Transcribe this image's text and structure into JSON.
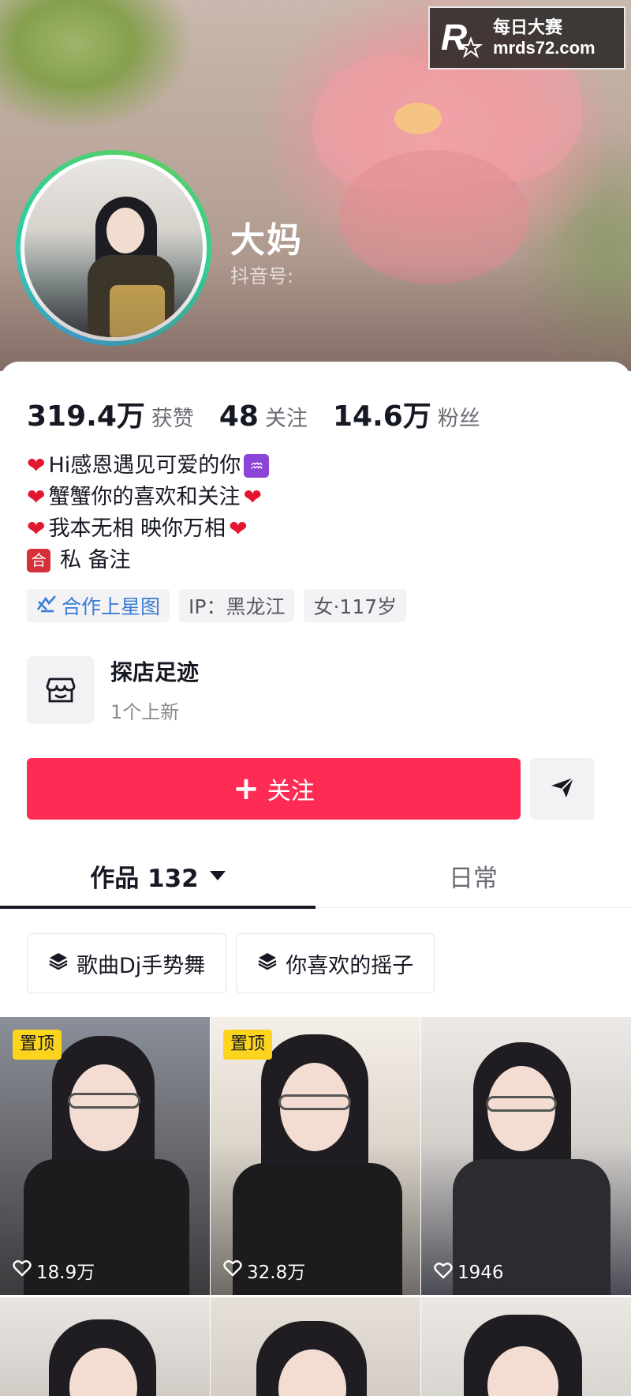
{
  "watermark": {
    "brand_line1": "每日大赛",
    "brand_line2": "mrds72.com",
    "logo_letter": "R"
  },
  "profile": {
    "name": "大妈",
    "douyin_id_label": "抖音号:",
    "stats": [
      {
        "value": "319.4万",
        "label": "获赞"
      },
      {
        "value": "48",
        "label": "关注"
      },
      {
        "value": "14.6万",
        "label": "粉丝"
      }
    ],
    "bio": [
      {
        "prefix_icon": "heart-icon",
        "text": "Hi感恩遇见可爱的你",
        "suffix_icon": "aquarius-icon"
      },
      {
        "prefix_icon": "heart-icon",
        "text": "蟹蟹你的喜欢和关注",
        "suffix_icon": "heart-icon"
      },
      {
        "prefix_icon": "heart-icon",
        "text": "我本无相 映你万相",
        "suffix_icon": "heart-icon"
      },
      {
        "prefix_icon": "he-badge-icon",
        "badge_text": "合",
        "text": "私 备注"
      }
    ],
    "tags": [
      {
        "label": "合作上星图",
        "icon": "xingtu-icon",
        "color": "#3a7bd5"
      },
      {
        "label": "IP：黑龙江"
      },
      {
        "label": "女·117岁"
      }
    ],
    "shop": {
      "title": "探店足迹",
      "subtitle": "1个上新",
      "icon": "store-icon"
    }
  },
  "actions": {
    "follow_plus": "+",
    "follow_label": "关注",
    "follow_color": "#fe2c55",
    "send_icon": "send-icon"
  },
  "tabs": [
    {
      "label": "作品 132",
      "active": true
    },
    {
      "label": "日常",
      "active": false
    }
  ],
  "collections": [
    {
      "label": "歌曲Dj手势舞",
      "icon": "layers-icon"
    },
    {
      "label": "你喜欢的摇子",
      "icon": "layers-icon"
    }
  ],
  "videos": [
    {
      "pinned": true,
      "pin_label": "置顶",
      "likes": "18.9万"
    },
    {
      "pinned": true,
      "pin_label": "置顶",
      "likes": "32.8万"
    },
    {
      "pinned": false,
      "likes": "1946"
    },
    {
      "pinned": false,
      "likes": ""
    },
    {
      "pinned": false,
      "likes": ""
    },
    {
      "pinned": false,
      "likes": ""
    }
  ]
}
